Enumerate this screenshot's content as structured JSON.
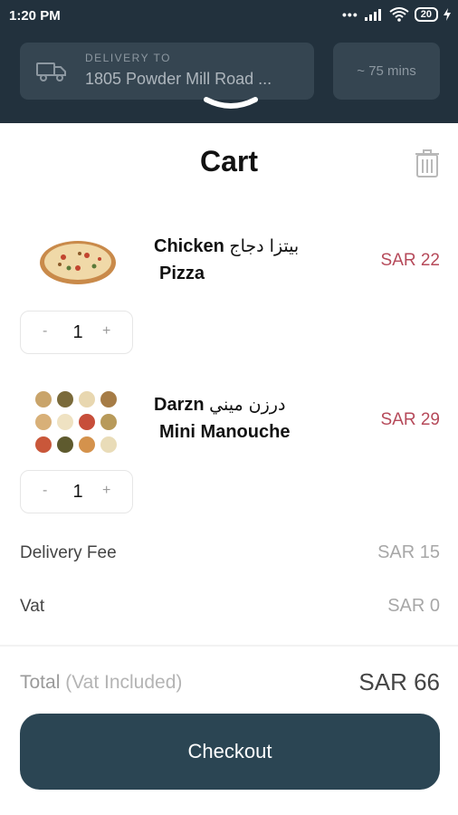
{
  "status_bar": {
    "time": "1:20 PM",
    "dots": "•••",
    "battery": "20"
  },
  "header": {
    "delivery_label": "DELIVERY TO",
    "delivery_address": "1805 Powder Mill Road ...",
    "eta": "~ 75 mins"
  },
  "cart": {
    "title": "Cart",
    "items": [
      {
        "name_en": "Chicken",
        "name_ar": "بيتزا دجاج",
        "name_line2": "Pizza",
        "price": "SAR 22",
        "qty": "1",
        "minus": "-",
        "plus": "+"
      },
      {
        "name_en": "Darzn",
        "name_ar": "درزن ميني",
        "name_line2": "Mini Manouche",
        "price": "SAR 29",
        "qty": "1",
        "minus": "-",
        "plus": "+"
      }
    ],
    "fees": [
      {
        "label": "Delivery Fee",
        "value": "SAR 15"
      },
      {
        "label": "Vat",
        "value": "SAR 0"
      }
    ],
    "total_label": "Total",
    "total_note": "(Vat Included)",
    "total_value": "SAR 66",
    "checkout_label": "Checkout"
  },
  "colors": {
    "header_bg": "#22313d",
    "price": "#b64a5a",
    "checkout_bg": "#2b4553"
  }
}
